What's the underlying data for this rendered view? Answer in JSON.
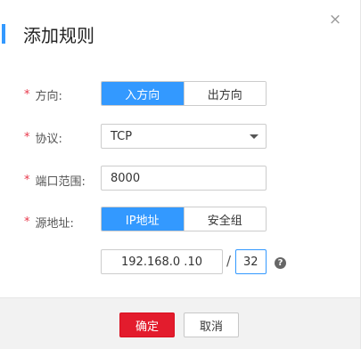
{
  "dialog": {
    "title": "添加规则",
    "close_glyph": "×",
    "accent_color": "#3399ff"
  },
  "required_mark": "*",
  "direction": {
    "label": "方向:",
    "options": [
      "入方向",
      "出方向"
    ],
    "selected": "入方向"
  },
  "protocol": {
    "label": "协议:",
    "value": "TCP"
  },
  "port_range": {
    "label": "端口范围:",
    "value": "8000"
  },
  "source": {
    "label": "源地址:",
    "options": [
      "IP地址",
      "安全组"
    ],
    "selected": "IP地址",
    "ip_value": "192.168.0  .10",
    "separator": "/",
    "mask_value": "32",
    "help_glyph": "?"
  },
  "footer": {
    "confirm_label": "确定",
    "cancel_label": "取消",
    "confirm_color": "#e31c2d"
  }
}
